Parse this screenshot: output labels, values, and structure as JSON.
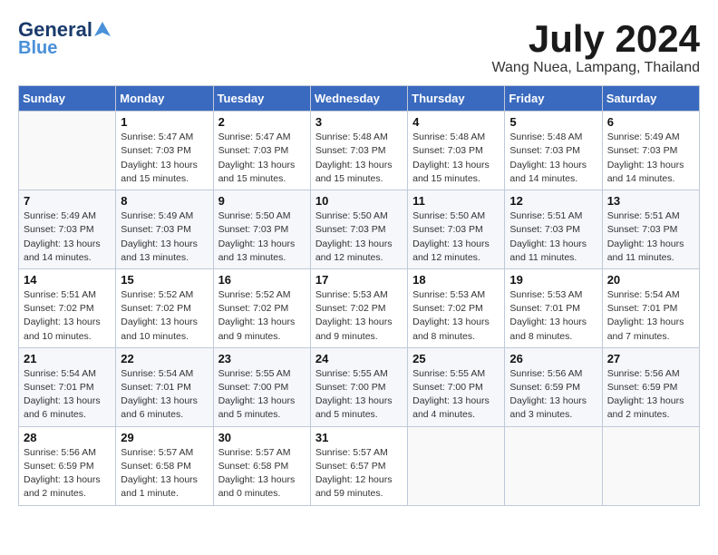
{
  "header": {
    "logo_general": "General",
    "logo_blue": "Blue",
    "month_year": "July 2024",
    "location": "Wang Nuea, Lampang, Thailand"
  },
  "days_of_week": [
    "Sunday",
    "Monday",
    "Tuesday",
    "Wednesday",
    "Thursday",
    "Friday",
    "Saturday"
  ],
  "weeks": [
    [
      {
        "day": "",
        "info": ""
      },
      {
        "day": "1",
        "info": "Sunrise: 5:47 AM\nSunset: 7:03 PM\nDaylight: 13 hours\nand 15 minutes."
      },
      {
        "day": "2",
        "info": "Sunrise: 5:47 AM\nSunset: 7:03 PM\nDaylight: 13 hours\nand 15 minutes."
      },
      {
        "day": "3",
        "info": "Sunrise: 5:48 AM\nSunset: 7:03 PM\nDaylight: 13 hours\nand 15 minutes."
      },
      {
        "day": "4",
        "info": "Sunrise: 5:48 AM\nSunset: 7:03 PM\nDaylight: 13 hours\nand 15 minutes."
      },
      {
        "day": "5",
        "info": "Sunrise: 5:48 AM\nSunset: 7:03 PM\nDaylight: 13 hours\nand 14 minutes."
      },
      {
        "day": "6",
        "info": "Sunrise: 5:49 AM\nSunset: 7:03 PM\nDaylight: 13 hours\nand 14 minutes."
      }
    ],
    [
      {
        "day": "7",
        "info": "Sunrise: 5:49 AM\nSunset: 7:03 PM\nDaylight: 13 hours\nand 14 minutes."
      },
      {
        "day": "8",
        "info": "Sunrise: 5:49 AM\nSunset: 7:03 PM\nDaylight: 13 hours\nand 13 minutes."
      },
      {
        "day": "9",
        "info": "Sunrise: 5:50 AM\nSunset: 7:03 PM\nDaylight: 13 hours\nand 13 minutes."
      },
      {
        "day": "10",
        "info": "Sunrise: 5:50 AM\nSunset: 7:03 PM\nDaylight: 13 hours\nand 12 minutes."
      },
      {
        "day": "11",
        "info": "Sunrise: 5:50 AM\nSunset: 7:03 PM\nDaylight: 13 hours\nand 12 minutes."
      },
      {
        "day": "12",
        "info": "Sunrise: 5:51 AM\nSunset: 7:03 PM\nDaylight: 13 hours\nand 11 minutes."
      },
      {
        "day": "13",
        "info": "Sunrise: 5:51 AM\nSunset: 7:03 PM\nDaylight: 13 hours\nand 11 minutes."
      }
    ],
    [
      {
        "day": "14",
        "info": "Sunrise: 5:51 AM\nSunset: 7:02 PM\nDaylight: 13 hours\nand 10 minutes."
      },
      {
        "day": "15",
        "info": "Sunrise: 5:52 AM\nSunset: 7:02 PM\nDaylight: 13 hours\nand 10 minutes."
      },
      {
        "day": "16",
        "info": "Sunrise: 5:52 AM\nSunset: 7:02 PM\nDaylight: 13 hours\nand 9 minutes."
      },
      {
        "day": "17",
        "info": "Sunrise: 5:53 AM\nSunset: 7:02 PM\nDaylight: 13 hours\nand 9 minutes."
      },
      {
        "day": "18",
        "info": "Sunrise: 5:53 AM\nSunset: 7:02 PM\nDaylight: 13 hours\nand 8 minutes."
      },
      {
        "day": "19",
        "info": "Sunrise: 5:53 AM\nSunset: 7:01 PM\nDaylight: 13 hours\nand 8 minutes."
      },
      {
        "day": "20",
        "info": "Sunrise: 5:54 AM\nSunset: 7:01 PM\nDaylight: 13 hours\nand 7 minutes."
      }
    ],
    [
      {
        "day": "21",
        "info": "Sunrise: 5:54 AM\nSunset: 7:01 PM\nDaylight: 13 hours\nand 6 minutes."
      },
      {
        "day": "22",
        "info": "Sunrise: 5:54 AM\nSunset: 7:01 PM\nDaylight: 13 hours\nand 6 minutes."
      },
      {
        "day": "23",
        "info": "Sunrise: 5:55 AM\nSunset: 7:00 PM\nDaylight: 13 hours\nand 5 minutes."
      },
      {
        "day": "24",
        "info": "Sunrise: 5:55 AM\nSunset: 7:00 PM\nDaylight: 13 hours\nand 5 minutes."
      },
      {
        "day": "25",
        "info": "Sunrise: 5:55 AM\nSunset: 7:00 PM\nDaylight: 13 hours\nand 4 minutes."
      },
      {
        "day": "26",
        "info": "Sunrise: 5:56 AM\nSunset: 6:59 PM\nDaylight: 13 hours\nand 3 minutes."
      },
      {
        "day": "27",
        "info": "Sunrise: 5:56 AM\nSunset: 6:59 PM\nDaylight: 13 hours\nand 2 minutes."
      }
    ],
    [
      {
        "day": "28",
        "info": "Sunrise: 5:56 AM\nSunset: 6:59 PM\nDaylight: 13 hours\nand 2 minutes."
      },
      {
        "day": "29",
        "info": "Sunrise: 5:57 AM\nSunset: 6:58 PM\nDaylight: 13 hours\nand 1 minute."
      },
      {
        "day": "30",
        "info": "Sunrise: 5:57 AM\nSunset: 6:58 PM\nDaylight: 13 hours\nand 0 minutes."
      },
      {
        "day": "31",
        "info": "Sunrise: 5:57 AM\nSunset: 6:57 PM\nDaylight: 12 hours\nand 59 minutes."
      },
      {
        "day": "",
        "info": ""
      },
      {
        "day": "",
        "info": ""
      },
      {
        "day": "",
        "info": ""
      }
    ]
  ]
}
